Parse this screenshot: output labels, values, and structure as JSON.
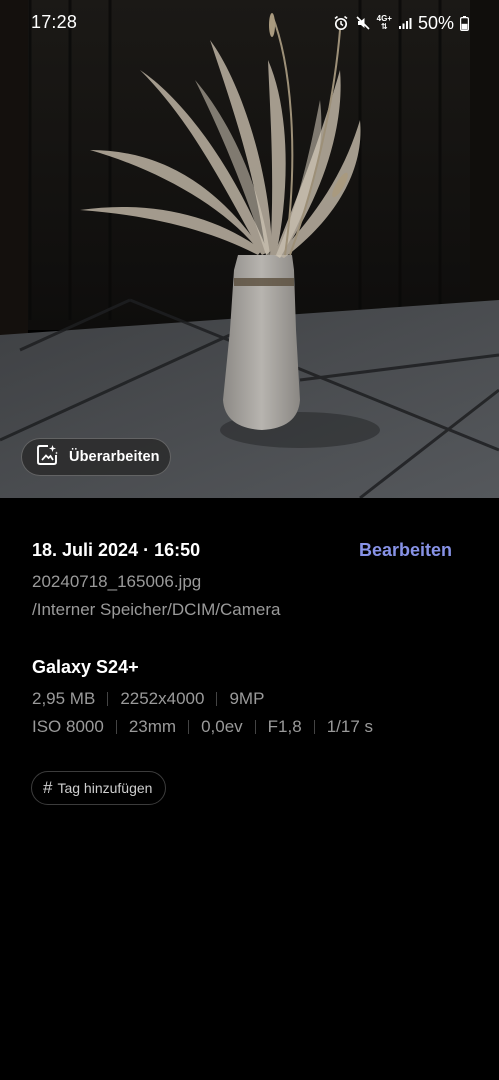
{
  "status_bar": {
    "time": "17:28",
    "network": "4G+",
    "battery": "50%",
    "icons": [
      "alarm-icon",
      "mute-icon",
      "network-icon",
      "signal-icon",
      "battery-icon"
    ]
  },
  "photo": {
    "edit_chip_label": "Überarbeiten",
    "edit_chip_icon": "ai-edit-icon"
  },
  "details": {
    "date_time": "18. Juli 2024 · 16:50",
    "edit_label": "Bearbeiten",
    "file_name": "20240718_165006.jpg",
    "file_path": "/Interner Speicher/DCIM/Camera",
    "device": "Galaxy S24+",
    "specs_row1": [
      "2,95 MB",
      "2252x4000",
      "9MP"
    ],
    "specs_row2": [
      "ISO 8000",
      "23mm",
      "0,0ev",
      "F1,8",
      "1/17 s"
    ],
    "tag_button_label": "Tag hinzufügen"
  },
  "colors": {
    "accent": "#8792e6",
    "background": "#000000",
    "secondary_text": "#9a9a9a"
  }
}
